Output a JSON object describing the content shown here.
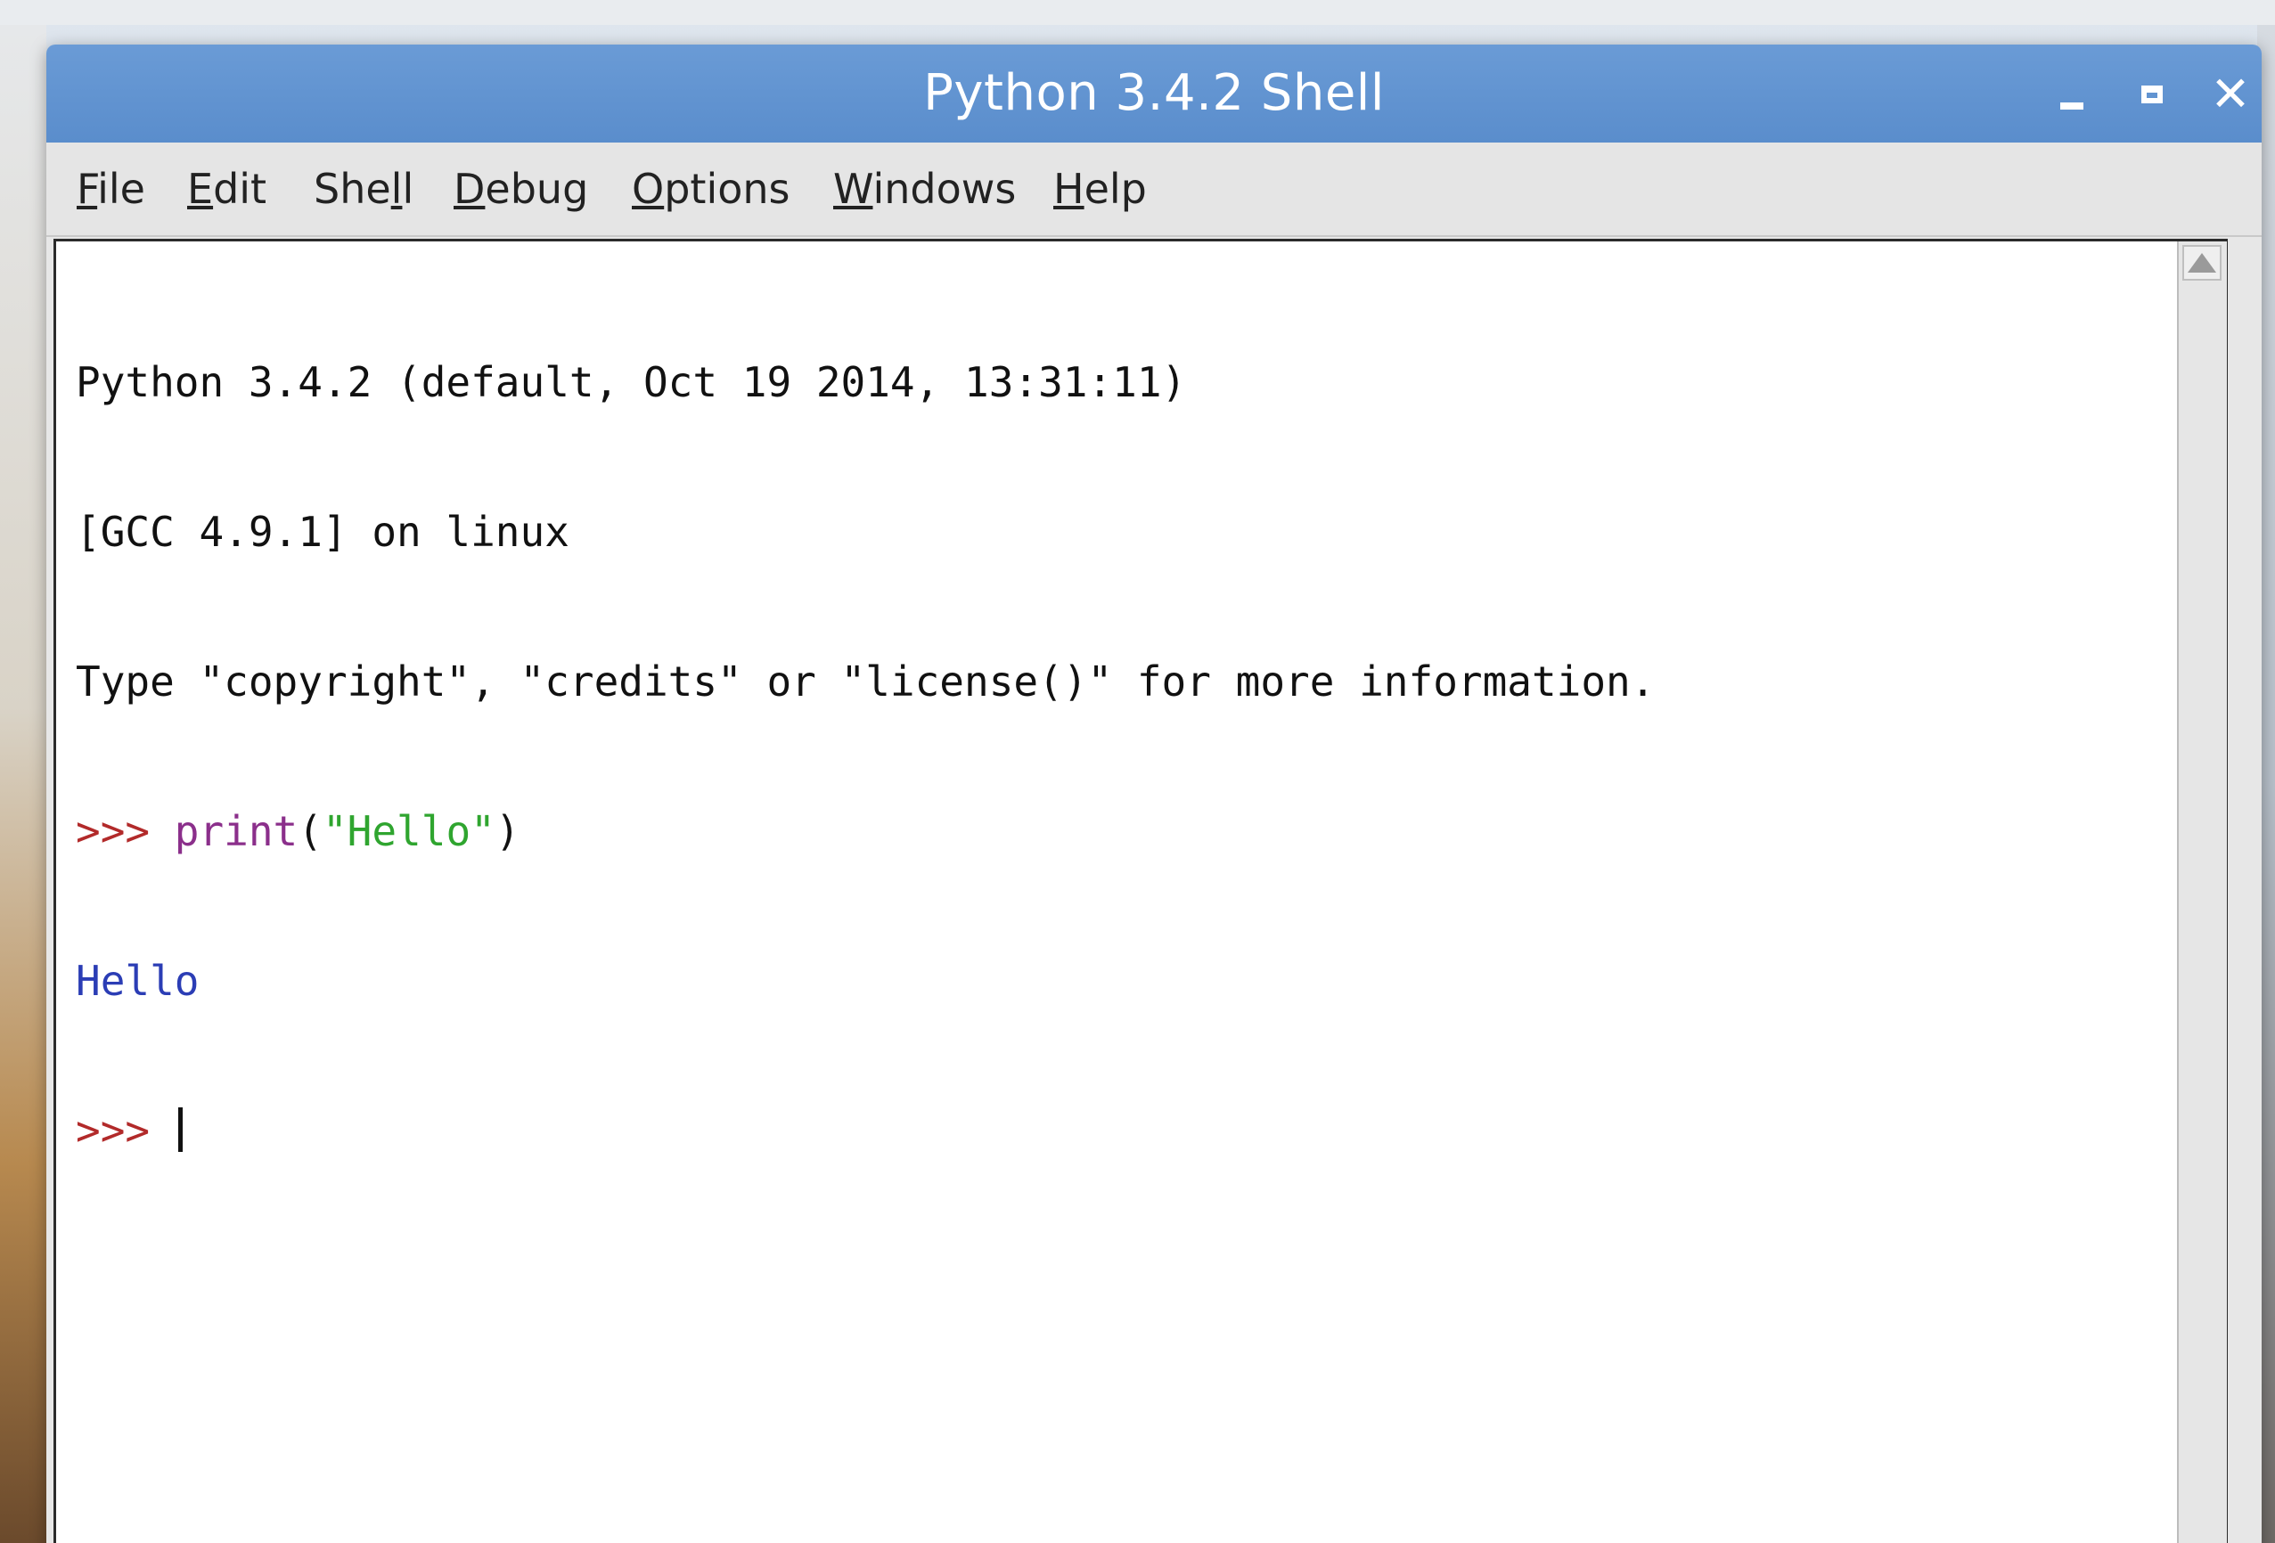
{
  "window": {
    "title": "Python 3.4.2 Shell",
    "controls": {
      "minimize": "_",
      "maximize": "□",
      "close": "✕"
    },
    "colors": {
      "titlebar": "#5a8dcc",
      "prompt": "#b22a2a",
      "builtin": "#8b2f8b",
      "string": "#2fa52f",
      "output": "#2b3db5"
    }
  },
  "menubar": {
    "items": [
      {
        "pre": "",
        "ul": "F",
        "post": "ile"
      },
      {
        "pre": "",
        "ul": "E",
        "post": "dit"
      },
      {
        "pre": "She",
        "ul": "l",
        "post": "l"
      },
      {
        "pre": "",
        "ul": "D",
        "post": "ebug"
      },
      {
        "pre": "",
        "ul": "O",
        "post": "ptions"
      },
      {
        "pre": "",
        "ul": "W",
        "post": "indows"
      },
      {
        "pre": "",
        "ul": "H",
        "post": "elp"
      }
    ]
  },
  "shell": {
    "banner": [
      "Python 3.4.2 (default, Oct 19 2014, 13:31:11)",
      "[GCC 4.9.1] on linux",
      "Type \"copyright\", \"credits\" or \"license()\" for more information."
    ],
    "input_line": {
      "prompt": ">>> ",
      "builtin": "print",
      "open_paren": "(",
      "string": "\"Hello\"",
      "close_paren": ")"
    },
    "output": "Hello",
    "current_prompt": ">>> "
  }
}
